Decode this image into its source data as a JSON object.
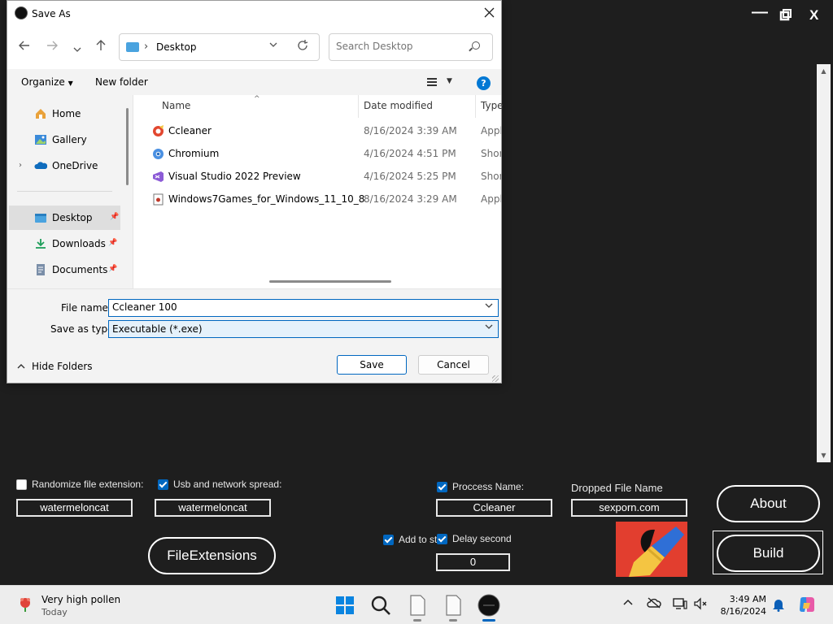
{
  "dialog": {
    "title": "Save As",
    "address_folder": "Desktop",
    "search_placeholder": "Search Desktop",
    "organize_label": "Organize",
    "new_folder_label": "New folder",
    "help_glyph": "?",
    "nav_items": [
      {
        "label": "Home",
        "icon": "home-icon"
      },
      {
        "label": "Gallery",
        "icon": "gallery-icon"
      },
      {
        "label": "OneDrive",
        "icon": "onedrive-icon"
      },
      {
        "label": "Desktop",
        "icon": "desktop-folder-icon",
        "selected": true
      },
      {
        "label": "Downloads",
        "icon": "downloads-icon"
      },
      {
        "label": "Documents",
        "icon": "documents-icon"
      }
    ],
    "columns": {
      "name": "Name",
      "date": "Date modified",
      "type": "Type"
    },
    "files": [
      {
        "name": "Ccleaner",
        "date": "8/16/2024 3:39 AM",
        "type": "Appli",
        "icon": "ccleaner-icon"
      },
      {
        "name": "Chromium",
        "date": "4/16/2024 4:51 PM",
        "type": "Short",
        "icon": "chromium-icon"
      },
      {
        "name": "Visual Studio 2022 Preview",
        "date": "4/16/2024 5:25 PM",
        "type": "Short",
        "icon": "visual-studio-icon"
      },
      {
        "name": "Windows7Games_for_Windows_11_10_8",
        "date": "8/16/2024 3:29 AM",
        "type": "Appli",
        "icon": "installer-icon"
      }
    ],
    "file_name_label": "File name:",
    "file_name_value": "Ccleaner 100",
    "save_type_label": "Save as type:",
    "save_type_value": "Executable (*.exe)",
    "hide_folders_label": "Hide Folders",
    "save_label": "Save",
    "cancel_label": "Cancel"
  },
  "app": {
    "window_controls": {
      "minimize": "—",
      "close": "X"
    },
    "randomize_label": "Randomize file extension:",
    "randomize_checked": false,
    "usb_label": "Usb and network spread:",
    "usb_checked": true,
    "field1_value": "watermeloncat",
    "field2_value": "watermeloncat",
    "process_label": "Proccess Name:",
    "process_checked": true,
    "process_value": "Ccleaner",
    "dropped_label": "Dropped File Name",
    "dropped_value": "sexporn.com",
    "add_startup_label": "Add to sta",
    "add_startup_checked": true,
    "delay_label": "Delay second",
    "delay_checked": true,
    "delay_value": "0",
    "file_extensions_label": "FileExtensions",
    "about_label": "About",
    "build_label": "Build",
    "colors": {
      "background": "#1e1e1e",
      "accent": "#0067c0",
      "logo_bg": "#e23e2f"
    }
  },
  "taskbar": {
    "weather_title": "Very high pollen",
    "weather_sub": "Today",
    "apps": [
      "start-icon",
      "search-icon",
      "file-icon",
      "file-icon",
      "builder-app-icon"
    ],
    "time": "3:49 AM",
    "date": "8/16/2024"
  }
}
